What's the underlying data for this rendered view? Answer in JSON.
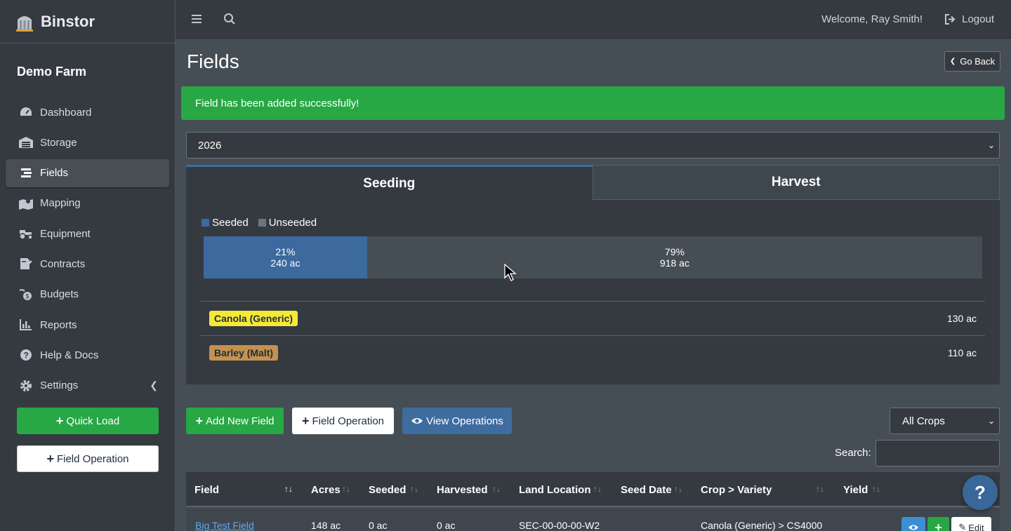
{
  "brand": {
    "name": "Binstor"
  },
  "farm": {
    "name": "Demo Farm"
  },
  "sidebar": {
    "items": [
      {
        "label": "Dashboard",
        "icon": "dashboard-icon"
      },
      {
        "label": "Storage",
        "icon": "warehouse-icon"
      },
      {
        "label": "Fields",
        "icon": "fields-icon",
        "active": true
      },
      {
        "label": "Mapping",
        "icon": "map-icon"
      },
      {
        "label": "Equipment",
        "icon": "tractor-icon"
      },
      {
        "label": "Contracts",
        "icon": "contract-icon"
      },
      {
        "label": "Budgets",
        "icon": "budget-icon"
      },
      {
        "label": "Reports",
        "icon": "chart-icon"
      },
      {
        "label": "Help & Docs",
        "icon": "help-icon"
      },
      {
        "label": "Settings",
        "icon": "gear-icon"
      }
    ],
    "quick_load": "Quick Load",
    "field_operation": "Field Operation"
  },
  "topbar": {
    "welcome": "Welcome, Ray Smith!",
    "logout": "Logout"
  },
  "page": {
    "title": "Fields",
    "go_back": "Go Back",
    "alert": "Field has been added successfully!",
    "year": "2026"
  },
  "tabs": {
    "seeding": "Seeding",
    "harvest": "Harvest"
  },
  "progress": {
    "legend_seeded": "Seeded",
    "legend_unseeded": "Unseeded",
    "seeded_pct_label": "21%",
    "seeded_ac": "240 ac",
    "unseeded_pct_label": "79%",
    "unseeded_ac": "918 ac",
    "seeded_fraction": 0.21,
    "colors": {
      "seeded": "#3c6a9e",
      "unseeded": "#464e55"
    }
  },
  "crops": [
    {
      "name": "Canola (Generic)",
      "acres": "130 ac",
      "color": "#f5e936"
    },
    {
      "name": "Barley (Malt)",
      "acres": "110 ac",
      "color": "#c4924f"
    }
  ],
  "actions": {
    "add_field": "Add New Field",
    "field_operation": "Field Operation",
    "view_operations": "View Operations",
    "crop_filter": "All Crops",
    "search_label": "Search:"
  },
  "table": {
    "headers": [
      "Field",
      "Acres",
      "Seeded",
      "Harvested",
      "Land Location",
      "Seed Date",
      "Crop > Variety",
      "Yield"
    ],
    "rows": [
      {
        "field": "Big Test Field",
        "acres": "148 ac",
        "seeded": "0 ac",
        "harvested": "0 ac",
        "land_location": "SEC-00-00-00-W2",
        "seed_date": "",
        "crop_variety": "Canola (Generic) > CS4000",
        "yield": "",
        "edit": "Edit"
      }
    ]
  },
  "help_fab": "?"
}
